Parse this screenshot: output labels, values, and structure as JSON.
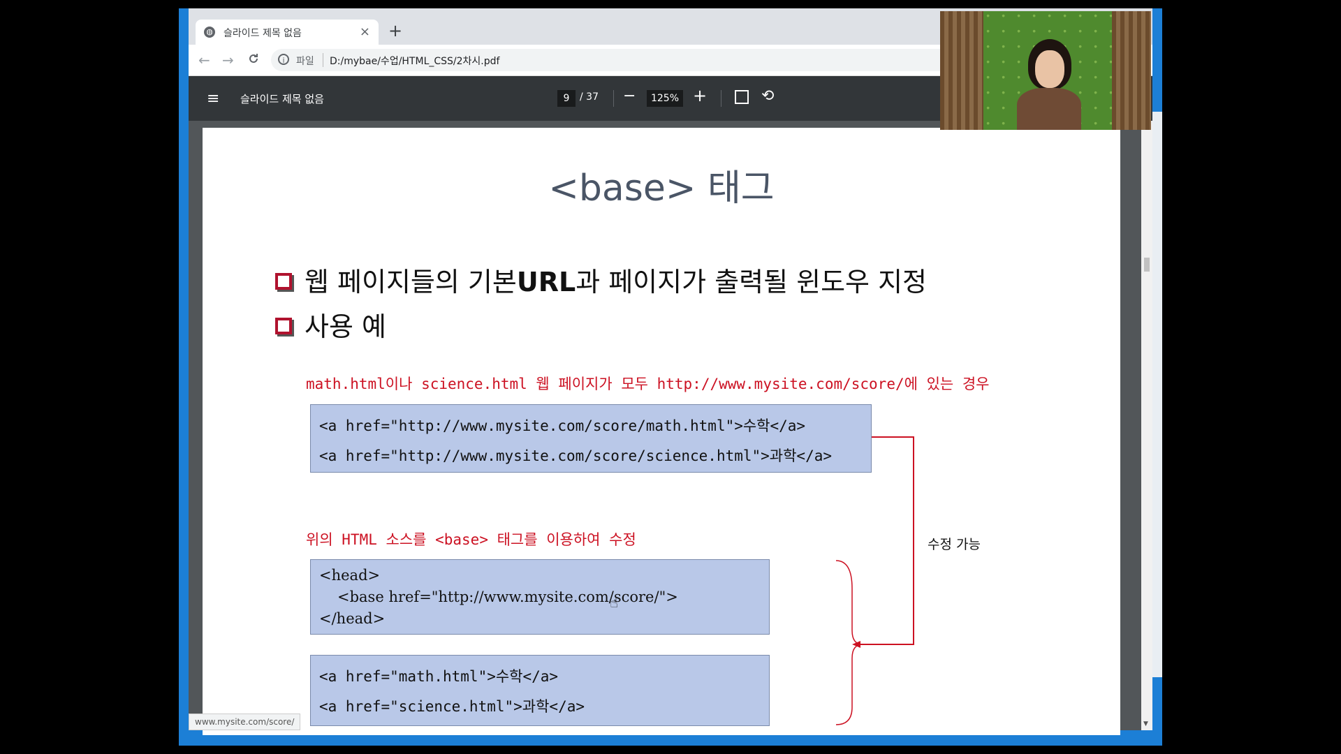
{
  "browser": {
    "tab_title": "슬라이드 제목 없음",
    "tab_close": "×",
    "new_tab": "+",
    "nav_back": "←",
    "nav_forward": "→",
    "nav_reload": "C",
    "address_info_icon": "i",
    "address_scheme": "파일",
    "address_url": "D:/mybae/수업/HTML_CSS/2차시.pdf",
    "status_url": "www.mysite.com/score/"
  },
  "pdf_toolbar": {
    "document_title": "슬라이드 제목 없음",
    "current_page": "9",
    "page_total": "/ 37",
    "zoom_out": "−",
    "zoom_level": "125%",
    "zoom_in": "+",
    "menu_icon": "≡"
  },
  "slide": {
    "title": "<base> 태그",
    "bullet1_prefix": "웹 페이지들의 기본",
    "bullet1_bold": "URL",
    "bullet1_suffix": "과 페이지가 출력될 윈도우 지정",
    "bullet2": "사용 예",
    "note1": "math.html이나 science.html 웹 페이지가 모두 http://www.mysite.com/score/에 있는 경우",
    "code1_line1": "<a href=\"http://www.mysite.com/score/math.html\">수학</a>",
    "code1_line2": "<a href=\"http://www.mysite.com/score/science.html\">과학</a>",
    "note2": "위의 HTML 소스를 <base> 태그를 이용하여 수정",
    "code2_line1": "<head>",
    "code2_line2": "<base href=\"http://www.mysite.com/score/\">",
    "code2_line3": "</head>",
    "code3_line1": "<a href=\"math.html\">수학</a>",
    "code3_line2": "<a href=\"science.html\">과학</a>",
    "annotation": "수정 가능"
  },
  "colors": {
    "accent_red": "#cc1122",
    "code_box": "#b9c8e8",
    "pdf_toolbar": "#323639"
  }
}
